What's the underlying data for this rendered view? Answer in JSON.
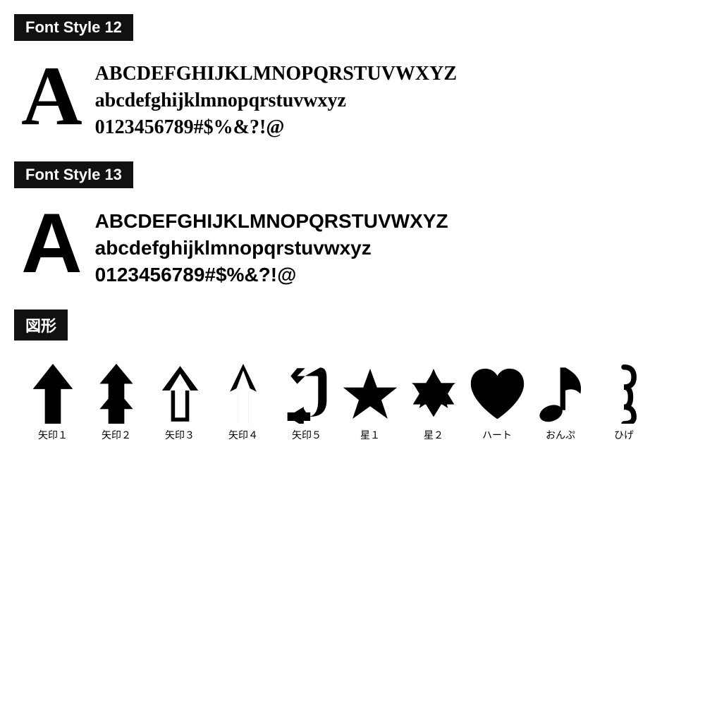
{
  "sections": [
    {
      "id": "font-style-12",
      "label": "Font Style 12",
      "big_letter": "A",
      "lines": [
        "ABCDEFGHIJKLMNOPQRSTUVWXYZ",
        "abcdefghijklmnopqrstuvwxyz",
        "0123456789#$%&?!@"
      ],
      "style_class": "style12"
    },
    {
      "id": "font-style-13",
      "label": "Font Style 13",
      "big_letter": "A",
      "lines": [
        "ABCDEFGHIJKLMNOPQRSTUVWXYZ",
        "abcdefghijklmnopqrstuvwxyz",
        "0123456789#$%&?!@"
      ],
      "style_class": "style13"
    },
    {
      "id": "shapes",
      "label": "図形"
    }
  ],
  "shapes": [
    {
      "id": "yajirushi1",
      "label": "矢印１",
      "type": "arrow1"
    },
    {
      "id": "yajirushi2",
      "label": "矢印２",
      "type": "arrow2"
    },
    {
      "id": "yajirushi3",
      "label": "矢印３",
      "type": "arrow3"
    },
    {
      "id": "yajirushi4",
      "label": "矢印４",
      "type": "arrow4"
    },
    {
      "id": "yajirushi5",
      "label": "矢印５",
      "type": "arrow5"
    },
    {
      "id": "hoshi1",
      "label": "星１",
      "type": "star1"
    },
    {
      "id": "hoshi2",
      "label": "星２",
      "type": "star2"
    },
    {
      "id": "heart",
      "label": "ハート",
      "type": "heart"
    },
    {
      "id": "onpu",
      "label": "おんぷ",
      "type": "music"
    },
    {
      "id": "hige",
      "label": "ひげ",
      "type": "hige"
    }
  ]
}
